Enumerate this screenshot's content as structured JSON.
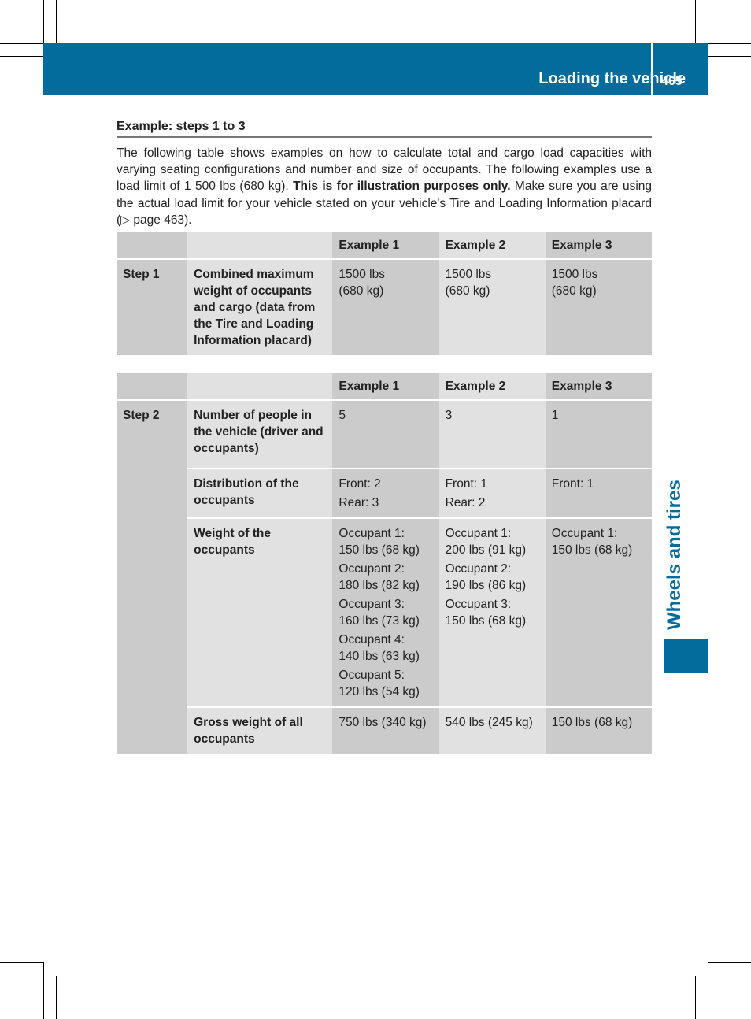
{
  "header": {
    "title": "Loading the vehicle",
    "page_number": "465",
    "accent_color": "#046b9d"
  },
  "side_tab": {
    "label": "Wheels and tires"
  },
  "section": {
    "title": "Example: steps 1 to 3",
    "intro_part1": "The following table shows examples on how to calculate total and cargo load capacities with varying seating configurations and number and size of occupants. The following examples use a load limit of 1 500 lbs (680 kg). ",
    "intro_bold": "This is for illustration purposes only.",
    "intro_part2": " Make sure you are using the actual load limit for your vehicle stated on your vehicle's Tire and Loading Information placard (",
    "page_ref_icon": "triangle-right-icon",
    "page_ref": "page 463",
    "intro_end": ")."
  },
  "table1": {
    "headers": [
      "",
      "",
      "Example 1",
      "Example 2",
      "Example 3"
    ],
    "step": "Step 1",
    "rows": [
      {
        "label": "Combined maximum weight of occupants and cargo (data from the Tire and Loading Information placard)",
        "values": [
          [
            "1500 lbs",
            "(680 kg)"
          ],
          [
            "1500 lbs",
            "(680 kg)"
          ],
          [
            "1500 lbs",
            "(680 kg)"
          ]
        ]
      }
    ]
  },
  "table2": {
    "headers": [
      "",
      "",
      "Example 1",
      "Example 2",
      "Example 3"
    ],
    "step": "Step 2",
    "rows": [
      {
        "label": "Number of people in the vehicle (driver and occupants)",
        "values": [
          "5",
          "3",
          "1"
        ]
      },
      {
        "label": "Distribution of the occupants",
        "values": [
          [
            "Front: 2",
            "Rear: 3"
          ],
          [
            "Front: 1",
            "Rear: 2"
          ],
          [
            "Front: 1"
          ]
        ]
      },
      {
        "label": "Weight of the occupants",
        "values": [
          [
            {
              "name": "Occupant 1:",
              "weight": "150 lbs (68 kg)"
            },
            {
              "name": "Occupant 2:",
              "weight": "180 lbs (82 kg)"
            },
            {
              "name": "Occupant 3:",
              "weight": "160 lbs (73 kg)"
            },
            {
              "name": "Occupant 4:",
              "weight": "140 lbs (63 kg)"
            },
            {
              "name": "Occupant 5:",
              "weight": "120 lbs (54 kg)"
            }
          ],
          [
            {
              "name": "Occupant 1:",
              "weight": "200 lbs (91 kg)"
            },
            {
              "name": "Occupant 2:",
              "weight": "190 lbs (86 kg)"
            },
            {
              "name": "Occupant 3:",
              "weight": "150 lbs (68 kg)"
            }
          ],
          [
            {
              "name": "Occupant 1:",
              "weight": "150 lbs (68 kg)"
            }
          ]
        ]
      },
      {
        "label": "Gross weight of all occupants",
        "values": [
          "750 lbs (340 kg)",
          "540 lbs (245 kg)",
          "150 lbs (68 kg)"
        ]
      }
    ]
  }
}
